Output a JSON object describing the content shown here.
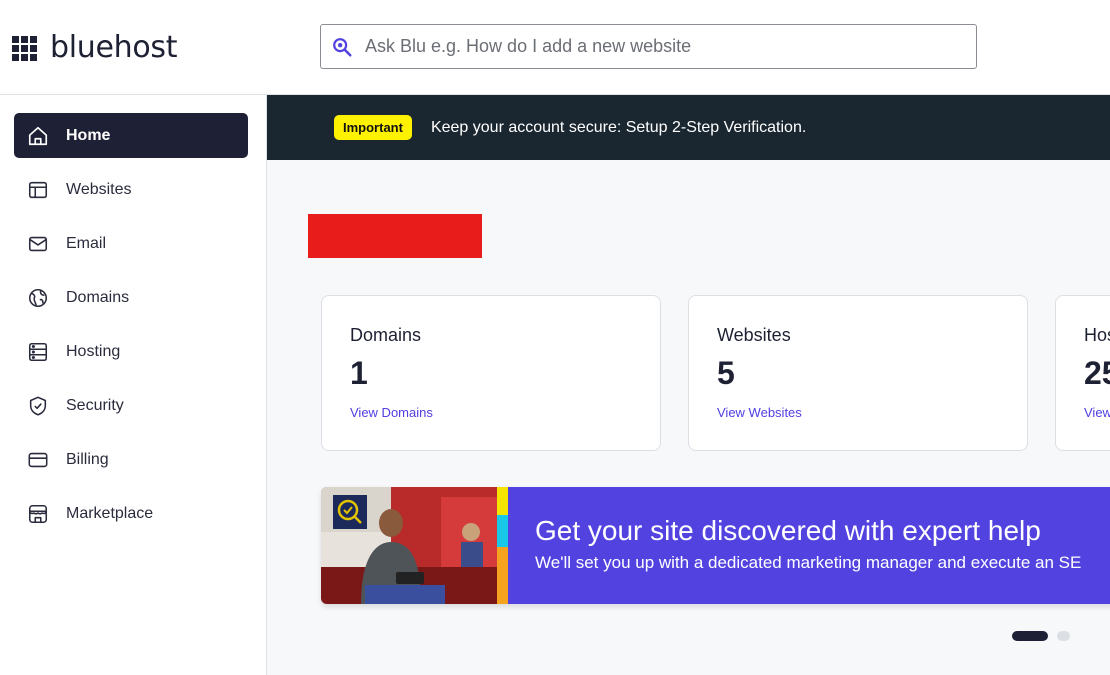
{
  "header": {
    "logo_text": "bluehost",
    "search_placeholder": "Ask Blu e.g. How do I add a new website"
  },
  "sidebar": {
    "items": [
      {
        "label": "Home",
        "icon": "home-icon",
        "active": true
      },
      {
        "label": "Websites",
        "icon": "websites-icon",
        "active": false
      },
      {
        "label": "Email",
        "icon": "email-icon",
        "active": false
      },
      {
        "label": "Domains",
        "icon": "globe-icon",
        "active": false
      },
      {
        "label": "Hosting",
        "icon": "server-icon",
        "active": false
      },
      {
        "label": "Security",
        "icon": "shield-icon",
        "active": false
      },
      {
        "label": "Billing",
        "icon": "credit-card-icon",
        "active": false
      },
      {
        "label": "Marketplace",
        "icon": "store-icon",
        "active": false
      }
    ]
  },
  "banner": {
    "badge": "Important",
    "message": "Keep your account secure: Setup 2-Step Verification."
  },
  "cards": [
    {
      "title": "Domains",
      "value": "1",
      "link": "View Domains"
    },
    {
      "title": "Websites",
      "value": "5",
      "link": "View Websites"
    },
    {
      "title": "Hos",
      "value": "25",
      "link": "View"
    }
  ],
  "promo": {
    "title": "Get your site discovered with expert help",
    "subtitle": "We'll set you up with a dedicated marketing manager and execute an SE"
  },
  "carousel": {
    "current": 1,
    "total": 2
  },
  "colors": {
    "accent": "#5243e0",
    "nav_active": "#1e2135",
    "banner_bg": "#1b2730",
    "badge": "#fff200",
    "link": "#4f3ee0",
    "redaction": "#e91c1c"
  }
}
